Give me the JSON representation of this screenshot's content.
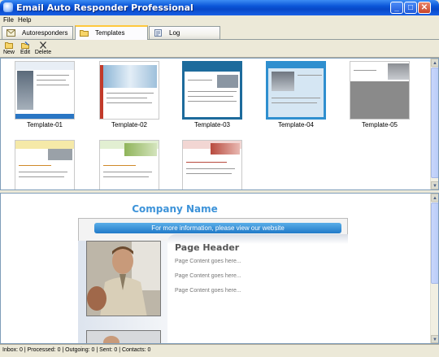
{
  "window": {
    "title": "Email Auto Responder Professional"
  },
  "menu": [
    "File",
    "Help"
  ],
  "tabs": [
    {
      "label": "Autoresponders",
      "icon": "envelope-icon"
    },
    {
      "label": "Templates",
      "icon": "folder-icon",
      "active": true
    },
    {
      "label": "Log",
      "icon": "log-icon"
    }
  ],
  "toolbar": {
    "new_label": "New",
    "edit_label": "Edit",
    "delete_label": "Delete"
  },
  "templates": [
    {
      "label": "Template-01"
    },
    {
      "label": "Template-02"
    },
    {
      "label": "Template-03"
    },
    {
      "label": "Template-04"
    },
    {
      "label": "Template-05"
    },
    {
      "label": ""
    },
    {
      "label": ""
    },
    {
      "label": ""
    }
  ],
  "preview": {
    "company_name": "Company Name",
    "info_bar": "For more information, please view our website",
    "page_header": "Page Header",
    "content_lines": [
      "Page Content goes here...",
      "Page Content goes here...",
      "Page Content goes here..."
    ]
  },
  "status": {
    "text": "Inbox: 0  |  Processed: 0  |  Outgoing: 0  |  Sent: 0  |  Contacts: 0"
  },
  "colors": {
    "titlebar": "#0a55d8",
    "accent_blue": "#3d93d9",
    "tab_highlight": "#ffc83c"
  }
}
